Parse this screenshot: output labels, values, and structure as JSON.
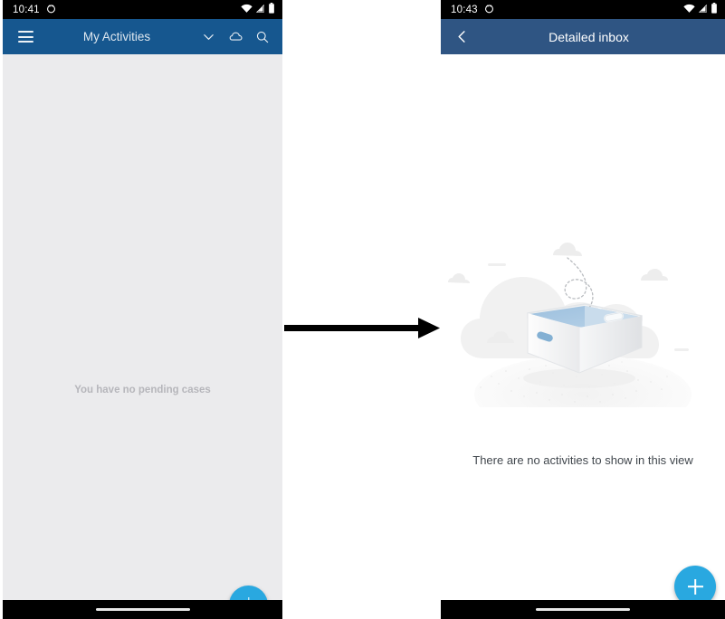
{
  "left_phone": {
    "status_bar": {
      "time": "10:41",
      "icons": [
        "alarm-icon",
        "wifi-icon",
        "signal-icon",
        "battery-icon"
      ]
    },
    "toolbar": {
      "menu_icon": "hamburger-menu-icon",
      "title": "My Activities",
      "actions": [
        "chevron-down-icon",
        "cloud-icon",
        "search-icon"
      ],
      "background_color": "#16578f"
    },
    "content": {
      "empty_message": "You have no pending cases",
      "background_color": "#ebebed"
    },
    "fab": {
      "label": "+",
      "icon": "plus-icon",
      "color": "#29a8e0"
    }
  },
  "right_phone": {
    "status_bar": {
      "time": "10:43",
      "icons": [
        "alarm-icon",
        "wifi-icon",
        "signal-icon",
        "battery-icon"
      ]
    },
    "toolbar": {
      "back_icon": "back-chevron-icon",
      "title": "Detailed inbox",
      "background_color": "#2f5583"
    },
    "content": {
      "illustration": "empty-box-clouds-illustration",
      "empty_message": "There are no activities to show in this view",
      "background_color": "#ffffff"
    },
    "fab": {
      "label": "+",
      "icon": "plus-icon",
      "color": "#29a8e0"
    }
  },
  "annotation": {
    "arrow": "right-pointing-arrow",
    "arrow_color": "#000000"
  }
}
